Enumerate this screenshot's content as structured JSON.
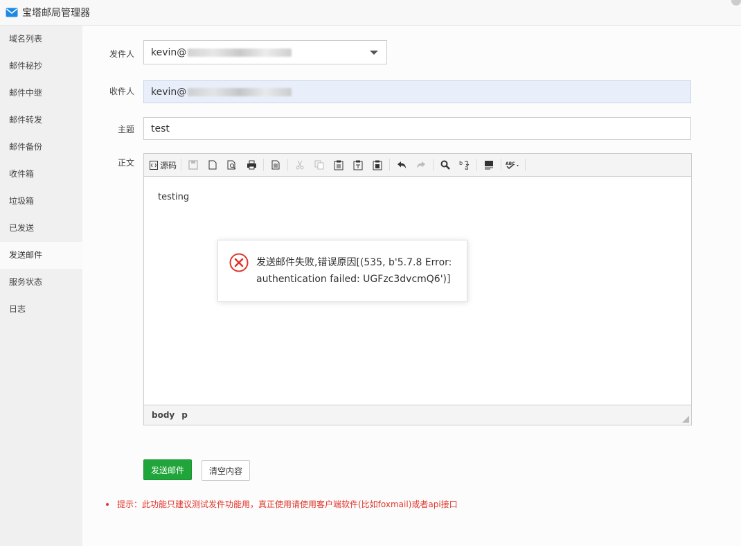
{
  "window": {
    "title": "宝塔邮局管理器"
  },
  "sidebar": {
    "items": [
      {
        "label": "域名列表"
      },
      {
        "label": "邮件秘抄"
      },
      {
        "label": "邮件中继"
      },
      {
        "label": "邮件转发"
      },
      {
        "label": "邮件备份"
      },
      {
        "label": "收件箱"
      },
      {
        "label": "垃圾箱"
      },
      {
        "label": "已发送"
      },
      {
        "label": "发送邮件"
      },
      {
        "label": "服务状态"
      },
      {
        "label": "日志"
      }
    ],
    "active_index": 8
  },
  "form": {
    "from_label": "发件人",
    "from_value": "kevin@",
    "to_label": "收件人",
    "to_value": "kevin@",
    "subject_label": "主题",
    "subject_value": "test",
    "body_label": "正文"
  },
  "editor": {
    "source_label": "源码",
    "content": "testing",
    "status_path": [
      "body",
      "p"
    ]
  },
  "dialog": {
    "message": "发送邮件失败,错误原因[(535, b'5.7.8 Error: authentication failed: UGFzc3dvcmQ6')]"
  },
  "actions": {
    "send_label": "发送邮件",
    "clear_label": "清空内容"
  },
  "hint": {
    "text": "提示：此功能只建议测试发件功能用，真正使用请使用客户端软件(比如foxmail)或者api接口"
  },
  "colors": {
    "primary": "#20a53a",
    "error": "#e0352b",
    "highlight_input": "#e8effa"
  }
}
